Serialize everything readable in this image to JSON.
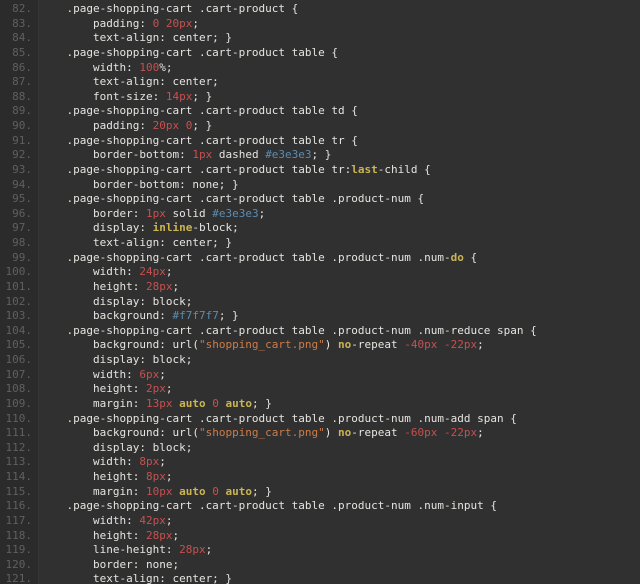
{
  "editor": {
    "name": "code-editor",
    "language": "css",
    "theme": "dark",
    "first_visible_line": 82,
    "last_visible_line": 121,
    "colors": {
      "gutter_background": "#2b2b2b",
      "editor_background": "#303031",
      "line_number": "#5e6061",
      "default_text": "#e6e4df",
      "number_token": "#c8504e",
      "hex_color_token": "#5c8cb0",
      "string_token": "#cc7c49",
      "keyword_token": "#cbb452"
    }
  },
  "lines": [
    {
      "n": "82.",
      "tokens": [
        {
          "t": "plain",
          "v": "    .page-shopping-cart .cart-product {"
        }
      ]
    },
    {
      "n": "83.",
      "tokens": [
        {
          "t": "plain",
          "v": "        padding: "
        },
        {
          "t": "num",
          "v": "0"
        },
        {
          "t": "plain",
          "v": " "
        },
        {
          "t": "num",
          "v": "20px"
        },
        {
          "t": "plain",
          "v": ";"
        }
      ]
    },
    {
      "n": "84.",
      "tokens": [
        {
          "t": "plain",
          "v": "        text-align: center; }"
        }
      ]
    },
    {
      "n": "85.",
      "tokens": [
        {
          "t": "plain",
          "v": "    .page-shopping-cart .cart-product table {"
        }
      ]
    },
    {
      "n": "86.",
      "tokens": [
        {
          "t": "plain",
          "v": "        width: "
        },
        {
          "t": "num",
          "v": "100"
        },
        {
          "t": "plain",
          "v": "%;"
        }
      ]
    },
    {
      "n": "87.",
      "tokens": [
        {
          "t": "plain",
          "v": "        text-align: center;"
        }
      ]
    },
    {
      "n": "88.",
      "tokens": [
        {
          "t": "plain",
          "v": "        font-size: "
        },
        {
          "t": "num",
          "v": "14px"
        },
        {
          "t": "plain",
          "v": "; }"
        }
      ]
    },
    {
      "n": "89.",
      "tokens": [
        {
          "t": "plain",
          "v": "    .page-shopping-cart .cart-product table td {"
        }
      ]
    },
    {
      "n": "90.",
      "tokens": [
        {
          "t": "plain",
          "v": "        padding: "
        },
        {
          "t": "num",
          "v": "20px"
        },
        {
          "t": "plain",
          "v": " "
        },
        {
          "t": "num",
          "v": "0"
        },
        {
          "t": "plain",
          "v": "; }"
        }
      ]
    },
    {
      "n": "91.",
      "tokens": [
        {
          "t": "plain",
          "v": "    .page-shopping-cart .cart-product table tr {"
        }
      ]
    },
    {
      "n": "92.",
      "tokens": [
        {
          "t": "plain",
          "v": "        border-bottom: "
        },
        {
          "t": "num",
          "v": "1px"
        },
        {
          "t": "plain",
          "v": " dashed "
        },
        {
          "t": "hex",
          "v": "#e3e3e3"
        },
        {
          "t": "plain",
          "v": "; }"
        }
      ]
    },
    {
      "n": "93.",
      "tokens": [
        {
          "t": "plain",
          "v": "    .page-shopping-cart .cart-product table tr:"
        },
        {
          "t": "kw",
          "v": "last"
        },
        {
          "t": "plain",
          "v": "-child {"
        }
      ]
    },
    {
      "n": "94.",
      "tokens": [
        {
          "t": "plain",
          "v": "        border-bottom: none; }"
        }
      ]
    },
    {
      "n": "95.",
      "tokens": [
        {
          "t": "plain",
          "v": "    .page-shopping-cart .cart-product table .product-num {"
        }
      ]
    },
    {
      "n": "96.",
      "tokens": [
        {
          "t": "plain",
          "v": "        border: "
        },
        {
          "t": "num",
          "v": "1px"
        },
        {
          "t": "plain",
          "v": " solid "
        },
        {
          "t": "hex",
          "v": "#e3e3e3"
        },
        {
          "t": "plain",
          "v": ";"
        }
      ]
    },
    {
      "n": "97.",
      "tokens": [
        {
          "t": "plain",
          "v": "        display: "
        },
        {
          "t": "kw",
          "v": "inline"
        },
        {
          "t": "plain",
          "v": "-block;"
        }
      ]
    },
    {
      "n": "98.",
      "tokens": [
        {
          "t": "plain",
          "v": "        text-align: center; }"
        }
      ]
    },
    {
      "n": "99.",
      "tokens": [
        {
          "t": "plain",
          "v": "    .page-shopping-cart .cart-product table .product-num .num-"
        },
        {
          "t": "kw",
          "v": "do"
        },
        {
          "t": "plain",
          "v": " {"
        }
      ]
    },
    {
      "n": "100.",
      "tokens": [
        {
          "t": "plain",
          "v": "        width: "
        },
        {
          "t": "num",
          "v": "24px"
        },
        {
          "t": "plain",
          "v": ";"
        }
      ]
    },
    {
      "n": "101.",
      "tokens": [
        {
          "t": "plain",
          "v": "        height: "
        },
        {
          "t": "num",
          "v": "28px"
        },
        {
          "t": "plain",
          "v": ";"
        }
      ]
    },
    {
      "n": "102.",
      "tokens": [
        {
          "t": "plain",
          "v": "        display: block;"
        }
      ]
    },
    {
      "n": "103.",
      "tokens": [
        {
          "t": "plain",
          "v": "        background: "
        },
        {
          "t": "hex",
          "v": "#f7f7f7"
        },
        {
          "t": "plain",
          "v": "; }"
        }
      ]
    },
    {
      "n": "104.",
      "tokens": [
        {
          "t": "plain",
          "v": "    .page-shopping-cart .cart-product table .product-num .num-reduce span {"
        }
      ]
    },
    {
      "n": "105.",
      "tokens": [
        {
          "t": "plain",
          "v": "        background: url("
        },
        {
          "t": "str",
          "v": "\"shopping_cart.png\""
        },
        {
          "t": "plain",
          "v": ") "
        },
        {
          "t": "kw",
          "v": "no"
        },
        {
          "t": "plain",
          "v": "-repeat "
        },
        {
          "t": "num",
          "v": "-40px"
        },
        {
          "t": "plain",
          "v": " "
        },
        {
          "t": "num",
          "v": "-22px"
        },
        {
          "t": "plain",
          "v": ";"
        }
      ]
    },
    {
      "n": "106.",
      "tokens": [
        {
          "t": "plain",
          "v": "        display: block;"
        }
      ]
    },
    {
      "n": "107.",
      "tokens": [
        {
          "t": "plain",
          "v": "        width: "
        },
        {
          "t": "num",
          "v": "6px"
        },
        {
          "t": "plain",
          "v": ";"
        }
      ]
    },
    {
      "n": "108.",
      "tokens": [
        {
          "t": "plain",
          "v": "        height: "
        },
        {
          "t": "num",
          "v": "2px"
        },
        {
          "t": "plain",
          "v": ";"
        }
      ]
    },
    {
      "n": "109.",
      "tokens": [
        {
          "t": "plain",
          "v": "        margin: "
        },
        {
          "t": "num",
          "v": "13px"
        },
        {
          "t": "plain",
          "v": " "
        },
        {
          "t": "kw",
          "v": "auto"
        },
        {
          "t": "plain",
          "v": " "
        },
        {
          "t": "num",
          "v": "0"
        },
        {
          "t": "plain",
          "v": " "
        },
        {
          "t": "kw",
          "v": "auto"
        },
        {
          "t": "plain",
          "v": "; }"
        }
      ]
    },
    {
      "n": "110.",
      "tokens": [
        {
          "t": "plain",
          "v": "    .page-shopping-cart .cart-product table .product-num .num-add span {"
        }
      ]
    },
    {
      "n": "111.",
      "tokens": [
        {
          "t": "plain",
          "v": "        background: url("
        },
        {
          "t": "str",
          "v": "\"shopping_cart.png\""
        },
        {
          "t": "plain",
          "v": ") "
        },
        {
          "t": "kw",
          "v": "no"
        },
        {
          "t": "plain",
          "v": "-repeat "
        },
        {
          "t": "num",
          "v": "-60px"
        },
        {
          "t": "plain",
          "v": " "
        },
        {
          "t": "num",
          "v": "-22px"
        },
        {
          "t": "plain",
          "v": ";"
        }
      ]
    },
    {
      "n": "112.",
      "tokens": [
        {
          "t": "plain",
          "v": "        display: block;"
        }
      ]
    },
    {
      "n": "113.",
      "tokens": [
        {
          "t": "plain",
          "v": "        width: "
        },
        {
          "t": "num",
          "v": "8px"
        },
        {
          "t": "plain",
          "v": ";"
        }
      ]
    },
    {
      "n": "114.",
      "tokens": [
        {
          "t": "plain",
          "v": "        height: "
        },
        {
          "t": "num",
          "v": "8px"
        },
        {
          "t": "plain",
          "v": ";"
        }
      ]
    },
    {
      "n": "115.",
      "tokens": [
        {
          "t": "plain",
          "v": "        margin: "
        },
        {
          "t": "num",
          "v": "10px"
        },
        {
          "t": "plain",
          "v": " "
        },
        {
          "t": "kw",
          "v": "auto"
        },
        {
          "t": "plain",
          "v": " "
        },
        {
          "t": "num",
          "v": "0"
        },
        {
          "t": "plain",
          "v": " "
        },
        {
          "t": "kw",
          "v": "auto"
        },
        {
          "t": "plain",
          "v": "; }"
        }
      ]
    },
    {
      "n": "116.",
      "tokens": [
        {
          "t": "plain",
          "v": "    .page-shopping-cart .cart-product table .product-num .num-input {"
        }
      ]
    },
    {
      "n": "117.",
      "tokens": [
        {
          "t": "plain",
          "v": "        width: "
        },
        {
          "t": "num",
          "v": "42px"
        },
        {
          "t": "plain",
          "v": ";"
        }
      ]
    },
    {
      "n": "118.",
      "tokens": [
        {
          "t": "plain",
          "v": "        height: "
        },
        {
          "t": "num",
          "v": "28px"
        },
        {
          "t": "plain",
          "v": ";"
        }
      ]
    },
    {
      "n": "119.",
      "tokens": [
        {
          "t": "plain",
          "v": "        line-height: "
        },
        {
          "t": "num",
          "v": "28px"
        },
        {
          "t": "plain",
          "v": ";"
        }
      ]
    },
    {
      "n": "120.",
      "tokens": [
        {
          "t": "plain",
          "v": "        border: none;"
        }
      ]
    },
    {
      "n": "121.",
      "tokens": [
        {
          "t": "plain",
          "v": "        text-align: center; }"
        }
      ]
    }
  ]
}
